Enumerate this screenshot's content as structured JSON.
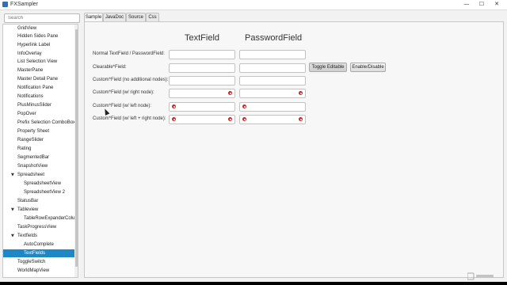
{
  "window": {
    "title": "FXSampler"
  },
  "sidebar": {
    "search_placeholder": "Search",
    "items": [
      {
        "label": "GridView"
      },
      {
        "label": "Hidden Sides Pane"
      },
      {
        "label": "Hyperlink Label"
      },
      {
        "label": "InfoOverlay"
      },
      {
        "label": "List Selection View"
      },
      {
        "label": "MasterPane"
      },
      {
        "label": "Master Detail Pane"
      },
      {
        "label": "Notification Pane"
      },
      {
        "label": "Notifications"
      },
      {
        "label": "PlusMinusSlider"
      },
      {
        "label": "PopOver"
      },
      {
        "label": "Prefix Selection ComboBox/C"
      },
      {
        "label": "Property Sheet"
      },
      {
        "label": "RangeSlider"
      },
      {
        "label": "Rating"
      },
      {
        "label": "SegmentedBar"
      },
      {
        "label": "SnapshotView"
      },
      {
        "label": "Spreadsheet"
      },
      {
        "label": "SpreadsheetView"
      },
      {
        "label": "SpreadsheetView 2"
      },
      {
        "label": "StatusBar"
      },
      {
        "label": "Tableview"
      },
      {
        "label": "TableRowExpanderColum"
      },
      {
        "label": "TaskProgressView"
      },
      {
        "label": "Textfields"
      },
      {
        "label": "AutoComplete"
      },
      {
        "label": "TextFields"
      },
      {
        "label": "ToggleSwitch"
      },
      {
        "label": "WorldMapView"
      }
    ]
  },
  "tabs": [
    {
      "label": "Sample"
    },
    {
      "label": "JavaDoc"
    },
    {
      "label": "Source"
    },
    {
      "label": "Css"
    }
  ],
  "main": {
    "col_textfield": "TextField",
    "col_passwordfield": "PasswordField",
    "rows": [
      {
        "label": "Normal TextField / PasswordField:"
      },
      {
        "label": "Clearable*Field:"
      },
      {
        "label": "Custom*Field (no additional nodes):"
      },
      {
        "label": "Custom*Field (w/ right node):"
      },
      {
        "label": "Custom*Field (w/ left node):"
      },
      {
        "label": "Custom*Field (w/ left + right node):"
      }
    ],
    "toggle_editable": "Toggle Editable",
    "enable_disable": "Enable/Disable"
  },
  "colors": {
    "selection": "#1e88c7",
    "badge": "#c62828",
    "app_icon": "#2e6fb5"
  }
}
